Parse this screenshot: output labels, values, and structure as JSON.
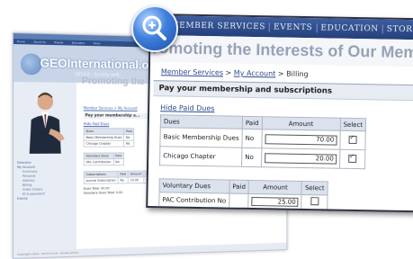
{
  "back_window": {
    "nav_items": [
      "Home",
      "About Us",
      "Events",
      "Education",
      "Store"
    ],
    "logo_text": "GEOInternational.org",
    "tagline": "GEOInt · Society and...",
    "heading": "Promoting the",
    "sidebar_menu": [
      {
        "label": "Directory",
        "sub": false
      },
      {
        "label": "My Account",
        "sub": false
      },
      {
        "label": "Summary",
        "sub": true
      },
      {
        "label": "Personal",
        "sub": true
      },
      {
        "label": "Address",
        "sub": true
      },
      {
        "label": "Billing",
        "sub": true
      },
      {
        "label": "Order history",
        "sub": true
      },
      {
        "label": "ID & password",
        "sub": true
      },
      {
        "label": "Events",
        "sub": false
      }
    ],
    "breadcrumb": "Member Services > My Account",
    "section_title": "Pay your membership a...",
    "hide_link": "Hide Paid Dues",
    "dues_header": [
      "Dues",
      "Paid"
    ],
    "dues_rows": [
      [
        "Basic Membership Dues",
        "No"
      ],
      [
        "Chicago Chapter",
        "No"
      ]
    ],
    "vol_header": [
      "Voluntary Dues",
      "Paid"
    ],
    "vol_rows": [
      [
        "PAC Contribution",
        "No"
      ]
    ],
    "sub_header": [
      "Subscriptions",
      "Paid",
      "Amount",
      "Select"
    ],
    "sub_rows": [
      [
        "Journal Subscription",
        "No",
        "10.00"
      ]
    ],
    "totals": [
      {
        "label": "Dues Total:",
        "value": "90.00"
      },
      {
        "label": "Voluntary Dues Total:",
        "value": "0.00"
      }
    ],
    "footer": "Copyright notice · terms of use · privacy policy"
  },
  "zoom_window": {
    "nav_items": [
      "T",
      "MEMBER SERVICES",
      "EVENTS",
      "EDUCATION",
      "STORE",
      "D"
    ],
    "banner": "romoting the Interests of Our Membe",
    "breadcrumb": {
      "item1": "Member Services",
      "sep1": " > ",
      "item2": "My Account",
      "sep2": " > ",
      "item3": "Billing"
    },
    "section_title": "Pay your membership and subscriptions",
    "hide_link": "Hide Paid Dues",
    "dues_header": {
      "col1": "Dues",
      "col2": "Paid",
      "col3": "Amount",
      "col4": "Select"
    },
    "dues_rows": [
      {
        "name": "Basic Membership Dues",
        "paid": "No",
        "amount": "70.00",
        "selected": true
      },
      {
        "name": "Chicago Chapter",
        "paid": "No",
        "amount": "20.00",
        "selected": true
      }
    ],
    "vol_header": {
      "col1": "Voluntary Dues",
      "col2": "Paid",
      "col3": "Amount",
      "col4": "Select"
    },
    "vol_rows": [
      {
        "name": "PAC Contribution",
        "paid": "No",
        "amount": "25.00",
        "selected": false
      }
    ]
  },
  "magnifier_icon": "magnifier-plus-icon"
}
